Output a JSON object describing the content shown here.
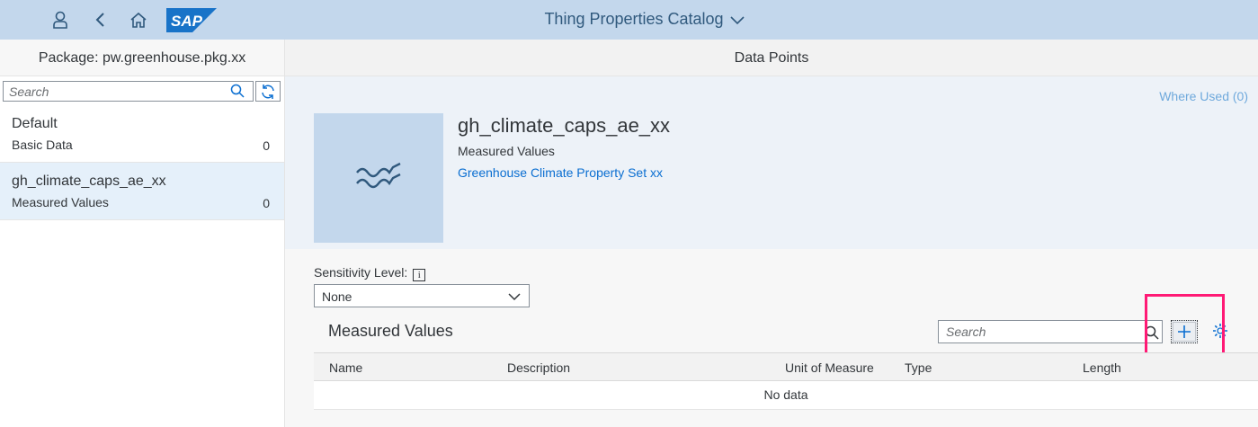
{
  "shell": {
    "title": "Thing Properties Catalog",
    "logo_text": "SAP",
    "icons": [
      "user-icon",
      "back-icon",
      "home-icon",
      "chevron-down-icon"
    ]
  },
  "master": {
    "header": "Package: pw.greenhouse.pkg.xx",
    "search_placeholder": "Search",
    "items": [
      {
        "title": "Default",
        "subtitle": "Basic Data",
        "count": "0"
      },
      {
        "title": "gh_climate_caps_ae_xx",
        "subtitle": "Measured Values",
        "count": "0"
      }
    ]
  },
  "detail": {
    "header": "Data Points",
    "where_used": "Where Used (0)",
    "object": {
      "title": "gh_climate_caps_ae_xx",
      "subtitle": "Measured Values",
      "link": "Greenhouse Climate Property Set xx"
    },
    "sensitivity": {
      "label": "Sensitivity Level:",
      "value": "None"
    },
    "table": {
      "title": "Measured Values",
      "search_placeholder": "Search",
      "columns": [
        "Name",
        "Description",
        "Unit of Measure",
        "Type",
        "Length"
      ],
      "empty_text": "No data"
    }
  },
  "colors": {
    "shell_bg": "#c3d7ec",
    "link": "#0a6ed1",
    "highlight": "#ff1a75",
    "selected_item": "#e5f0fa"
  }
}
